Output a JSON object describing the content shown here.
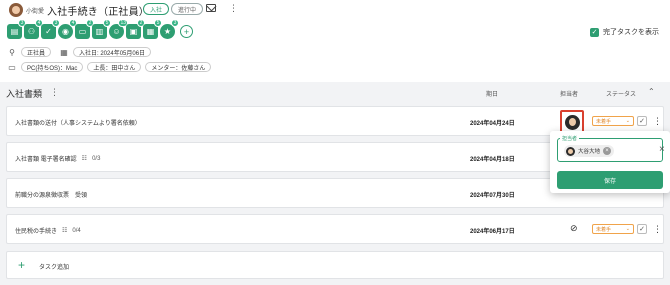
{
  "header": {
    "owner_name": "小街愛",
    "title": "入社手続き（正社員）",
    "tag_onboarding": "入社",
    "tag_status": "進行中",
    "icon_badges": [
      "3",
      "4",
      "3",
      "4",
      "2",
      "5",
      "13",
      "2",
      "5",
      "3"
    ],
    "show_completed_label": "完了タスクを表示",
    "meta": {
      "employment_type": "正社員",
      "join_date": "入社日: 2024年05月06日",
      "pc": "PC(持ちOS)：Mac",
      "boss": "上長：田中さん",
      "mentor": "メンター：佐藤さん"
    }
  },
  "section": {
    "title": "入社書類",
    "col_date": "期日",
    "col_assignee": "担当者",
    "col_status": "ステータス"
  },
  "tasks": [
    {
      "name": "入社書類の送付（人事システムより署名依頼）",
      "subtasks": "",
      "date": "2024年04月24日",
      "status": "未着手"
    },
    {
      "name": "入社書類 電子署名確認",
      "subtasks": "0/3",
      "date": "2024年04月18日",
      "status": ""
    },
    {
      "name": "前職分の源泉徴収票　受領",
      "subtasks": "",
      "date": "2024年07月30日",
      "status": ""
    },
    {
      "name": "住民税の手続き",
      "subtasks": "0/4",
      "date": "2024年06月17日",
      "status": "未着手"
    }
  ],
  "add_task_label": "タスク追加",
  "assignee_popup": {
    "field_label": "担当者",
    "selected_user": "大谷大地",
    "save_label": "保存"
  },
  "colors": {
    "accent": "#2e9e72",
    "status_orange": "#e0872a",
    "highlight_red": "#d9402f"
  },
  "icons": {
    "header": [
      "mail-icon",
      "kebab-icon"
    ],
    "toolbar": [
      "document-icon",
      "people-icon",
      "check-doc-icon",
      "location-icon",
      "device-icon",
      "book-icon",
      "person-icon",
      "card-icon",
      "folder-icon",
      "star-icon",
      "add-icon"
    ],
    "meta": [
      "person-icon",
      "calendar-icon",
      "folder-icon"
    ]
  }
}
